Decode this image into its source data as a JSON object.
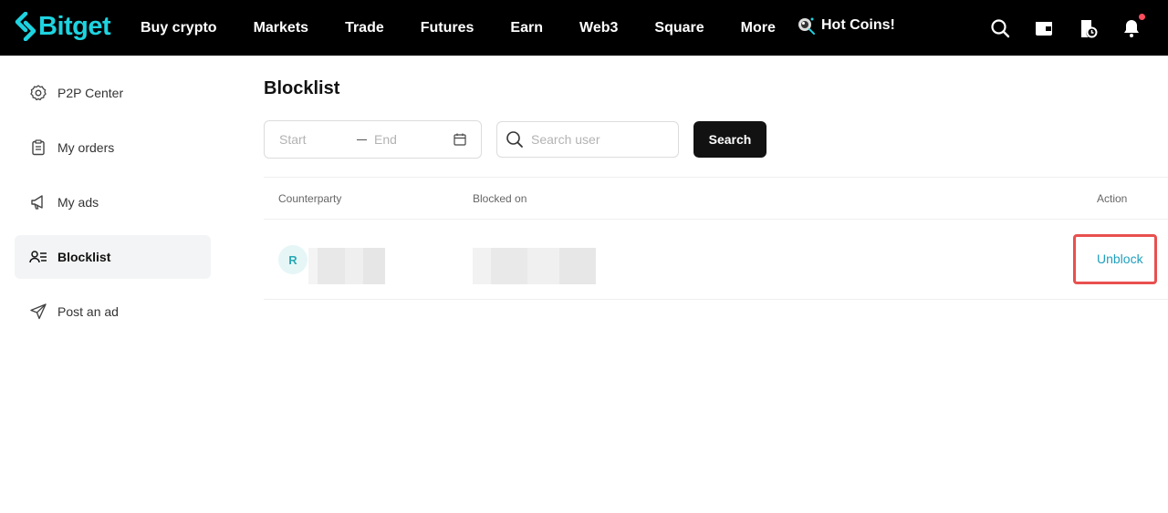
{
  "brand": {
    "name": "Bitget",
    "color": "#1ed3e0"
  },
  "nav": {
    "items": [
      {
        "label": "Buy crypto"
      },
      {
        "label": "Markets"
      },
      {
        "label": "Trade"
      },
      {
        "label": "Futures"
      },
      {
        "label": "Earn"
      },
      {
        "label": "Web3"
      },
      {
        "label": "Square"
      },
      {
        "label": "More"
      }
    ],
    "hot_label": "Hot Coins!",
    "icons": [
      "search-icon",
      "wallet-icon",
      "orders-icon",
      "bell-icon"
    ]
  },
  "sidebar": {
    "items": [
      {
        "label": "P2P Center",
        "icon": "gear-icon"
      },
      {
        "label": "My orders",
        "icon": "clipboard-icon"
      },
      {
        "label": "My ads",
        "icon": "megaphone-icon"
      },
      {
        "label": "Blocklist",
        "icon": "user-list-icon",
        "active": true
      },
      {
        "label": "Post an ad",
        "icon": "send-icon"
      }
    ]
  },
  "main": {
    "title": "Blocklist",
    "filters": {
      "start_placeholder": "Start",
      "end_placeholder": "End",
      "search_placeholder": "Search user",
      "search_button": "Search"
    },
    "table": {
      "headers": {
        "counterparty": "Counterparty",
        "blocked_on": "Blocked on",
        "action": "Action"
      },
      "rows": [
        {
          "avatar_initial": "R",
          "action_label": "Unblock"
        }
      ]
    }
  },
  "colors": {
    "highlight_border": "#e8504f",
    "link": "#1f9fbd",
    "notification_dot": "#ff4d5f"
  }
}
